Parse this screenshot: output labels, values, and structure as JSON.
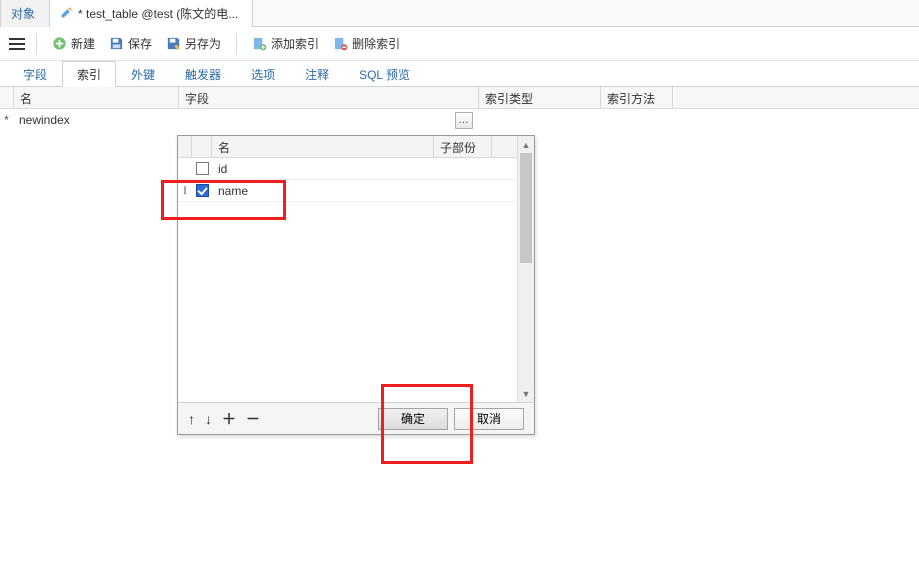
{
  "app_tabs": {
    "objects": "对象",
    "edit_label": "* test_table @test (陈文的电..."
  },
  "toolbar": {
    "new": "新建",
    "save": "保存",
    "save_as": "另存为",
    "add_index": "添加索引",
    "delete_index": "删除索引"
  },
  "prop_tabs": {
    "fields": "字段",
    "indexes": "索引",
    "fk": "外键",
    "triggers": "触发器",
    "options": "选项",
    "comment": "注释",
    "sql": "SQL 预览"
  },
  "index_table": {
    "head": {
      "name": "名",
      "field": "字段",
      "type": "索引类型",
      "method": "索引方法"
    },
    "row_marker": "*",
    "row": {
      "name": "newindex",
      "field": "",
      "type": "",
      "method": ""
    },
    "ellipsis": "…"
  },
  "popup": {
    "head": {
      "name": "名",
      "sub": "子部份"
    },
    "rows": [
      {
        "handle": "",
        "checked": false,
        "name": "id",
        "sub": ""
      },
      {
        "handle": "I",
        "checked": true,
        "name": "name",
        "sub": ""
      }
    ],
    "footer": {
      "up": "↑",
      "down": "↓",
      "plus": "＋",
      "minus": "－",
      "ok": "确定",
      "cancel": "取消"
    },
    "scroll": {
      "up": "▲",
      "down": "▼"
    }
  }
}
